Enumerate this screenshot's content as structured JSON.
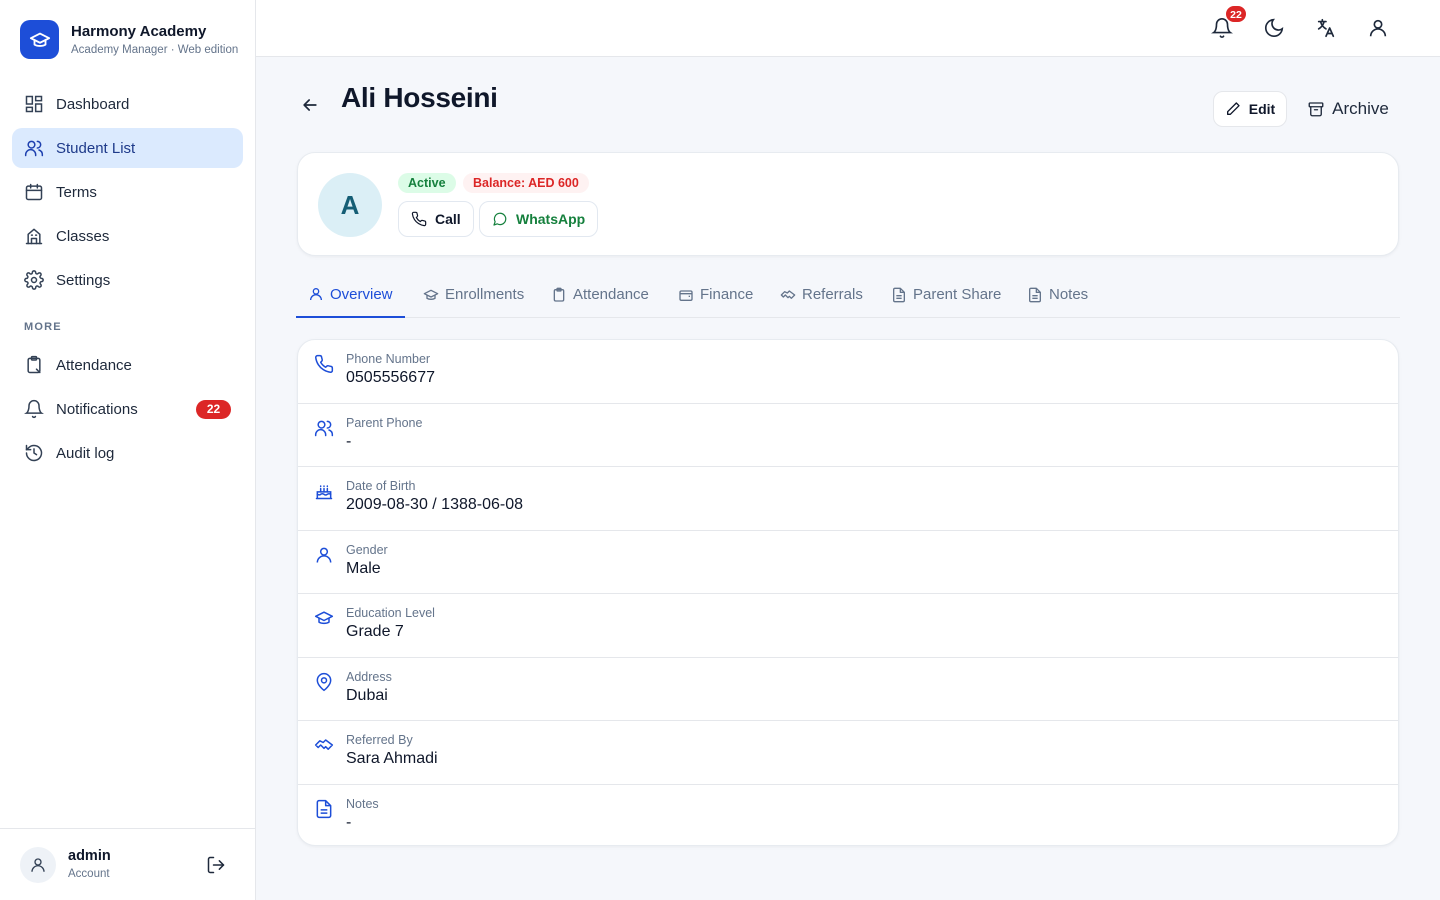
{
  "brand": {
    "name": "Harmony Academy",
    "subtitle": "Academy Manager · Web edition"
  },
  "sidebar": {
    "items": [
      {
        "label": "Dashboard",
        "icon": "dashboard-icon"
      },
      {
        "label": "Student List",
        "icon": "users-icon",
        "active": true
      },
      {
        "label": "Terms",
        "icon": "calendar-icon"
      },
      {
        "label": "Classes",
        "icon": "building-icon"
      },
      {
        "label": "Settings",
        "icon": "gear-icon"
      }
    ],
    "section_label": "MORE",
    "more_items": [
      {
        "label": "Attendance",
        "icon": "clipboard-icon"
      },
      {
        "label": "Notifications",
        "icon": "bell-icon",
        "badge": "22"
      },
      {
        "label": "Audit log",
        "icon": "history-icon"
      }
    ]
  },
  "account": {
    "name": "admin",
    "role": "Account"
  },
  "topbar": {
    "notification_count": "22"
  },
  "student": {
    "name": "Ali Hosseini",
    "initial": "A",
    "status": "Active",
    "balance": "Balance: AED 600"
  },
  "actions": {
    "edit": "Edit",
    "archive": "Archive",
    "call": "Call",
    "whatsapp": "WhatsApp"
  },
  "tabs": [
    "Overview",
    "Enrollments",
    "Attendance",
    "Finance",
    "Referrals",
    "Parent Share",
    "Notes"
  ],
  "details": [
    {
      "label": "Phone Number",
      "value": "0505556677",
      "icon": "phone-icon"
    },
    {
      "label": "Parent Phone",
      "value": "-",
      "icon": "users-icon"
    },
    {
      "label": "Date of Birth",
      "value": "2009-08-30 / 1388-06-08",
      "icon": "cake-icon"
    },
    {
      "label": "Gender",
      "value": "Male",
      "icon": "user-icon"
    },
    {
      "label": "Education Level",
      "value": "Grade 7",
      "icon": "graduation-cap-icon"
    },
    {
      "label": "Address",
      "value": "Dubai",
      "icon": "map-pin-icon"
    },
    {
      "label": "Referred By",
      "value": "Sara Ahmadi",
      "icon": "handshake-icon"
    },
    {
      "label": "Notes",
      "value": "-",
      "icon": "document-icon"
    }
  ],
  "colors": {
    "accent": "#1d4ed8",
    "active_bg": "#dbeafe",
    "success": "#15803d",
    "danger": "#dc2626"
  }
}
